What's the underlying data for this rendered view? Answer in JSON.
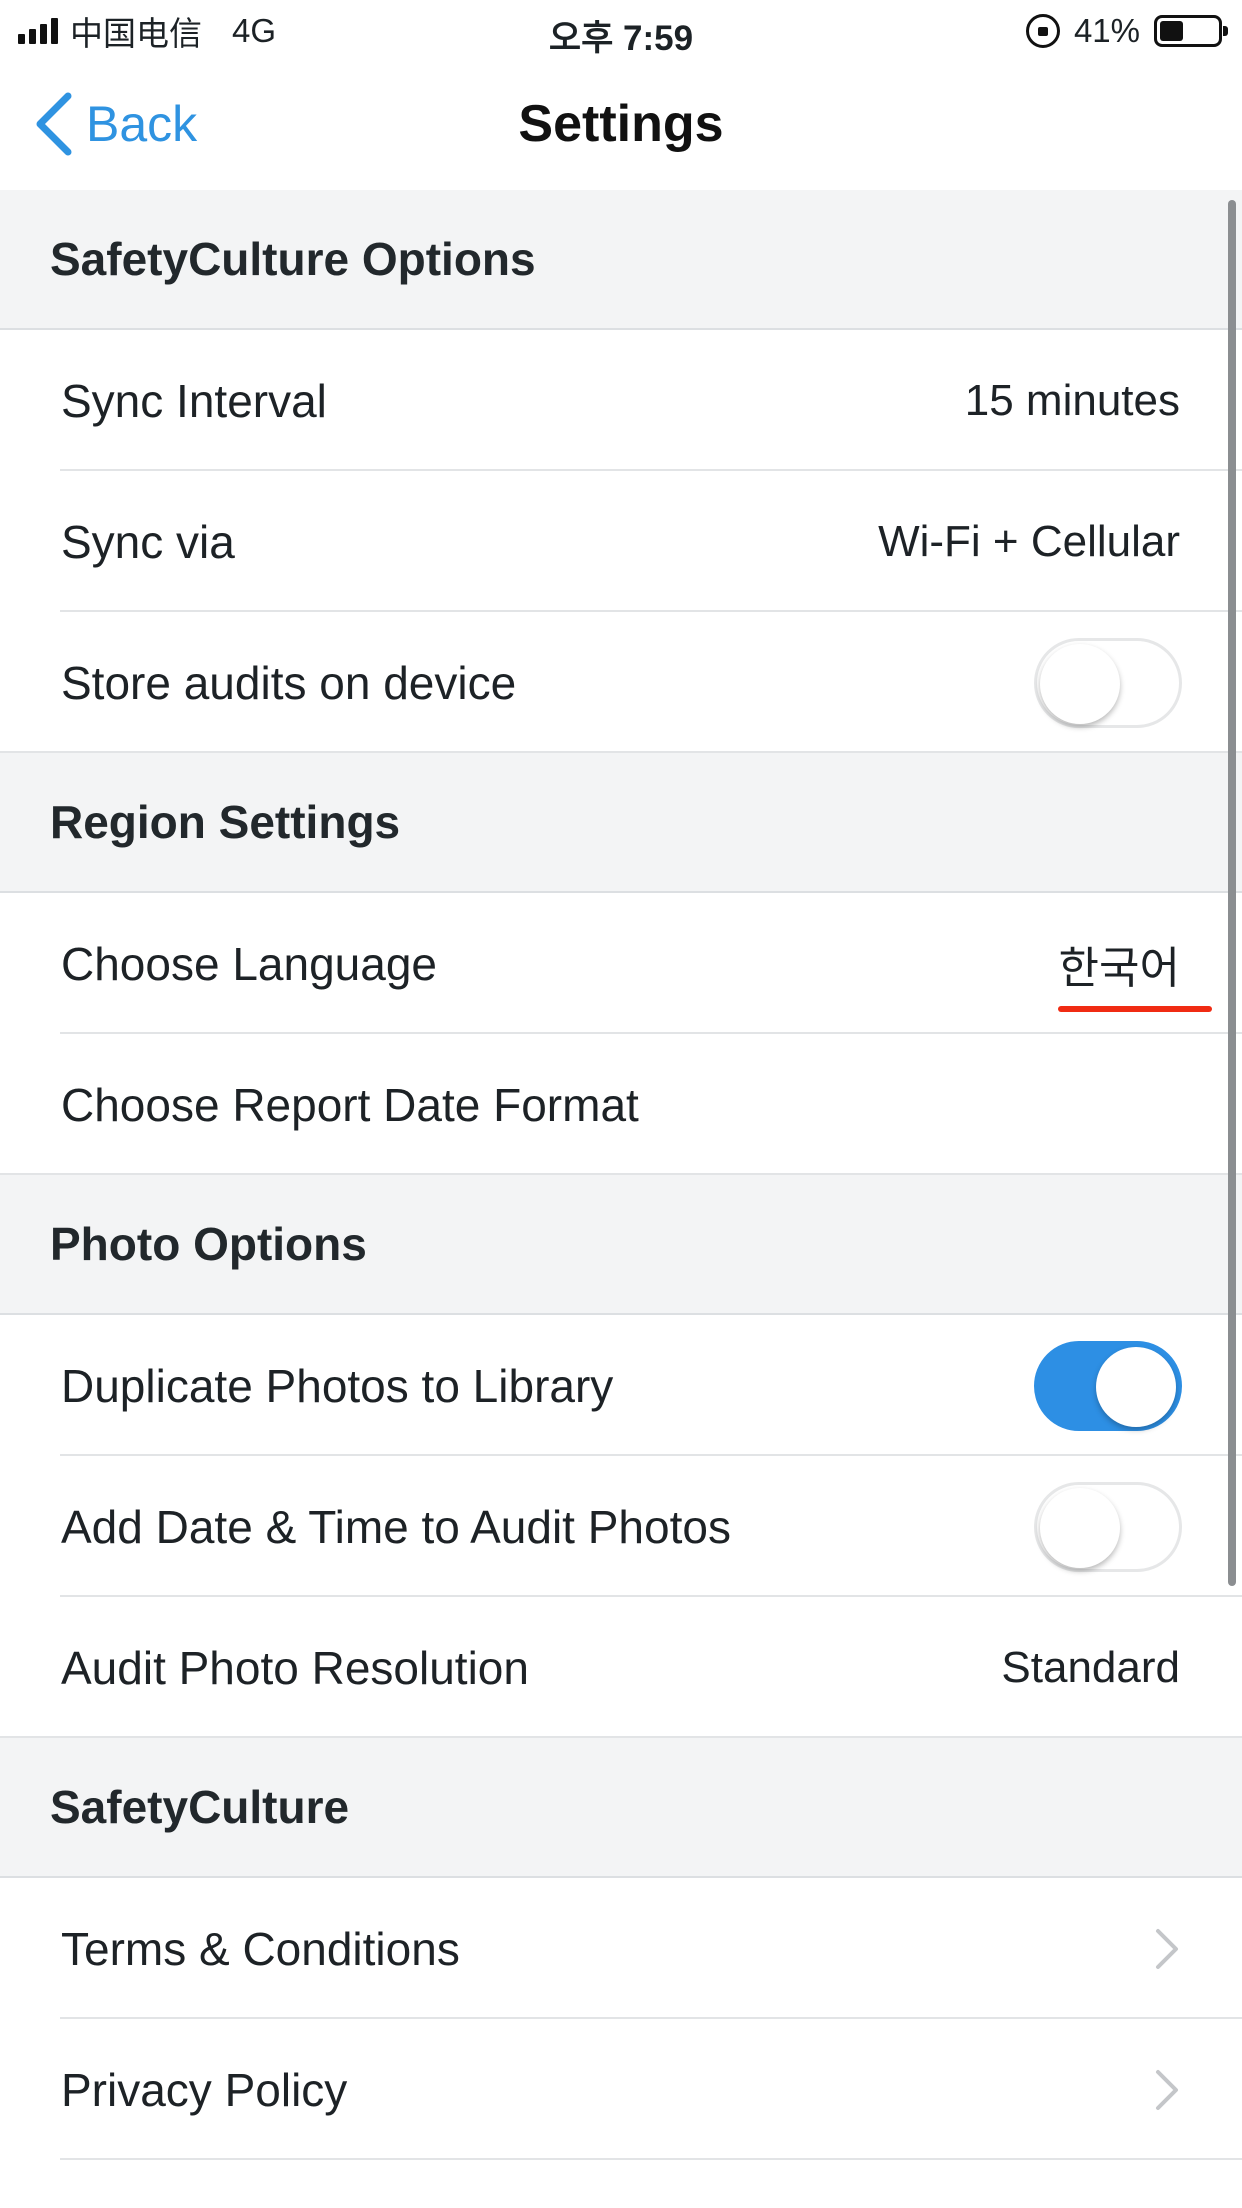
{
  "status_bar": {
    "carrier": "中国电信",
    "network": "4G",
    "time": "오후 7:59",
    "battery_percent": "41%",
    "battery_level": 0.41
  },
  "nav": {
    "back_label": "Back",
    "title": "Settings"
  },
  "sections": {
    "safetyculture_options": {
      "header": "SafetyCulture Options",
      "sync_interval_label": "Sync Interval",
      "sync_interval_value": "15 minutes",
      "sync_via_label": "Sync via",
      "sync_via_value": "Wi-Fi + Cellular",
      "store_audits_label": "Store audits on device",
      "store_audits_on": false
    },
    "region_settings": {
      "header": "Region Settings",
      "choose_language_label": "Choose Language",
      "choose_language_value": "한국어",
      "report_date_format_label": "Choose Report Date Format"
    },
    "photo_options": {
      "header": "Photo Options",
      "duplicate_photos_label": "Duplicate Photos to Library",
      "duplicate_photos_on": true,
      "add_datetime_label": "Add Date & Time to Audit Photos",
      "add_datetime_on": false,
      "resolution_label": "Audit Photo Resolution",
      "resolution_value": "Standard"
    },
    "safetyculture": {
      "header": "SafetyCulture",
      "terms_label": "Terms & Conditions",
      "privacy_label": "Privacy Policy"
    }
  },
  "colors": {
    "accent": "#2f93e1",
    "toggle_on": "#2d8fe4",
    "annotation_underline": "#f02b13",
    "section_background": "#f3f4f5"
  }
}
